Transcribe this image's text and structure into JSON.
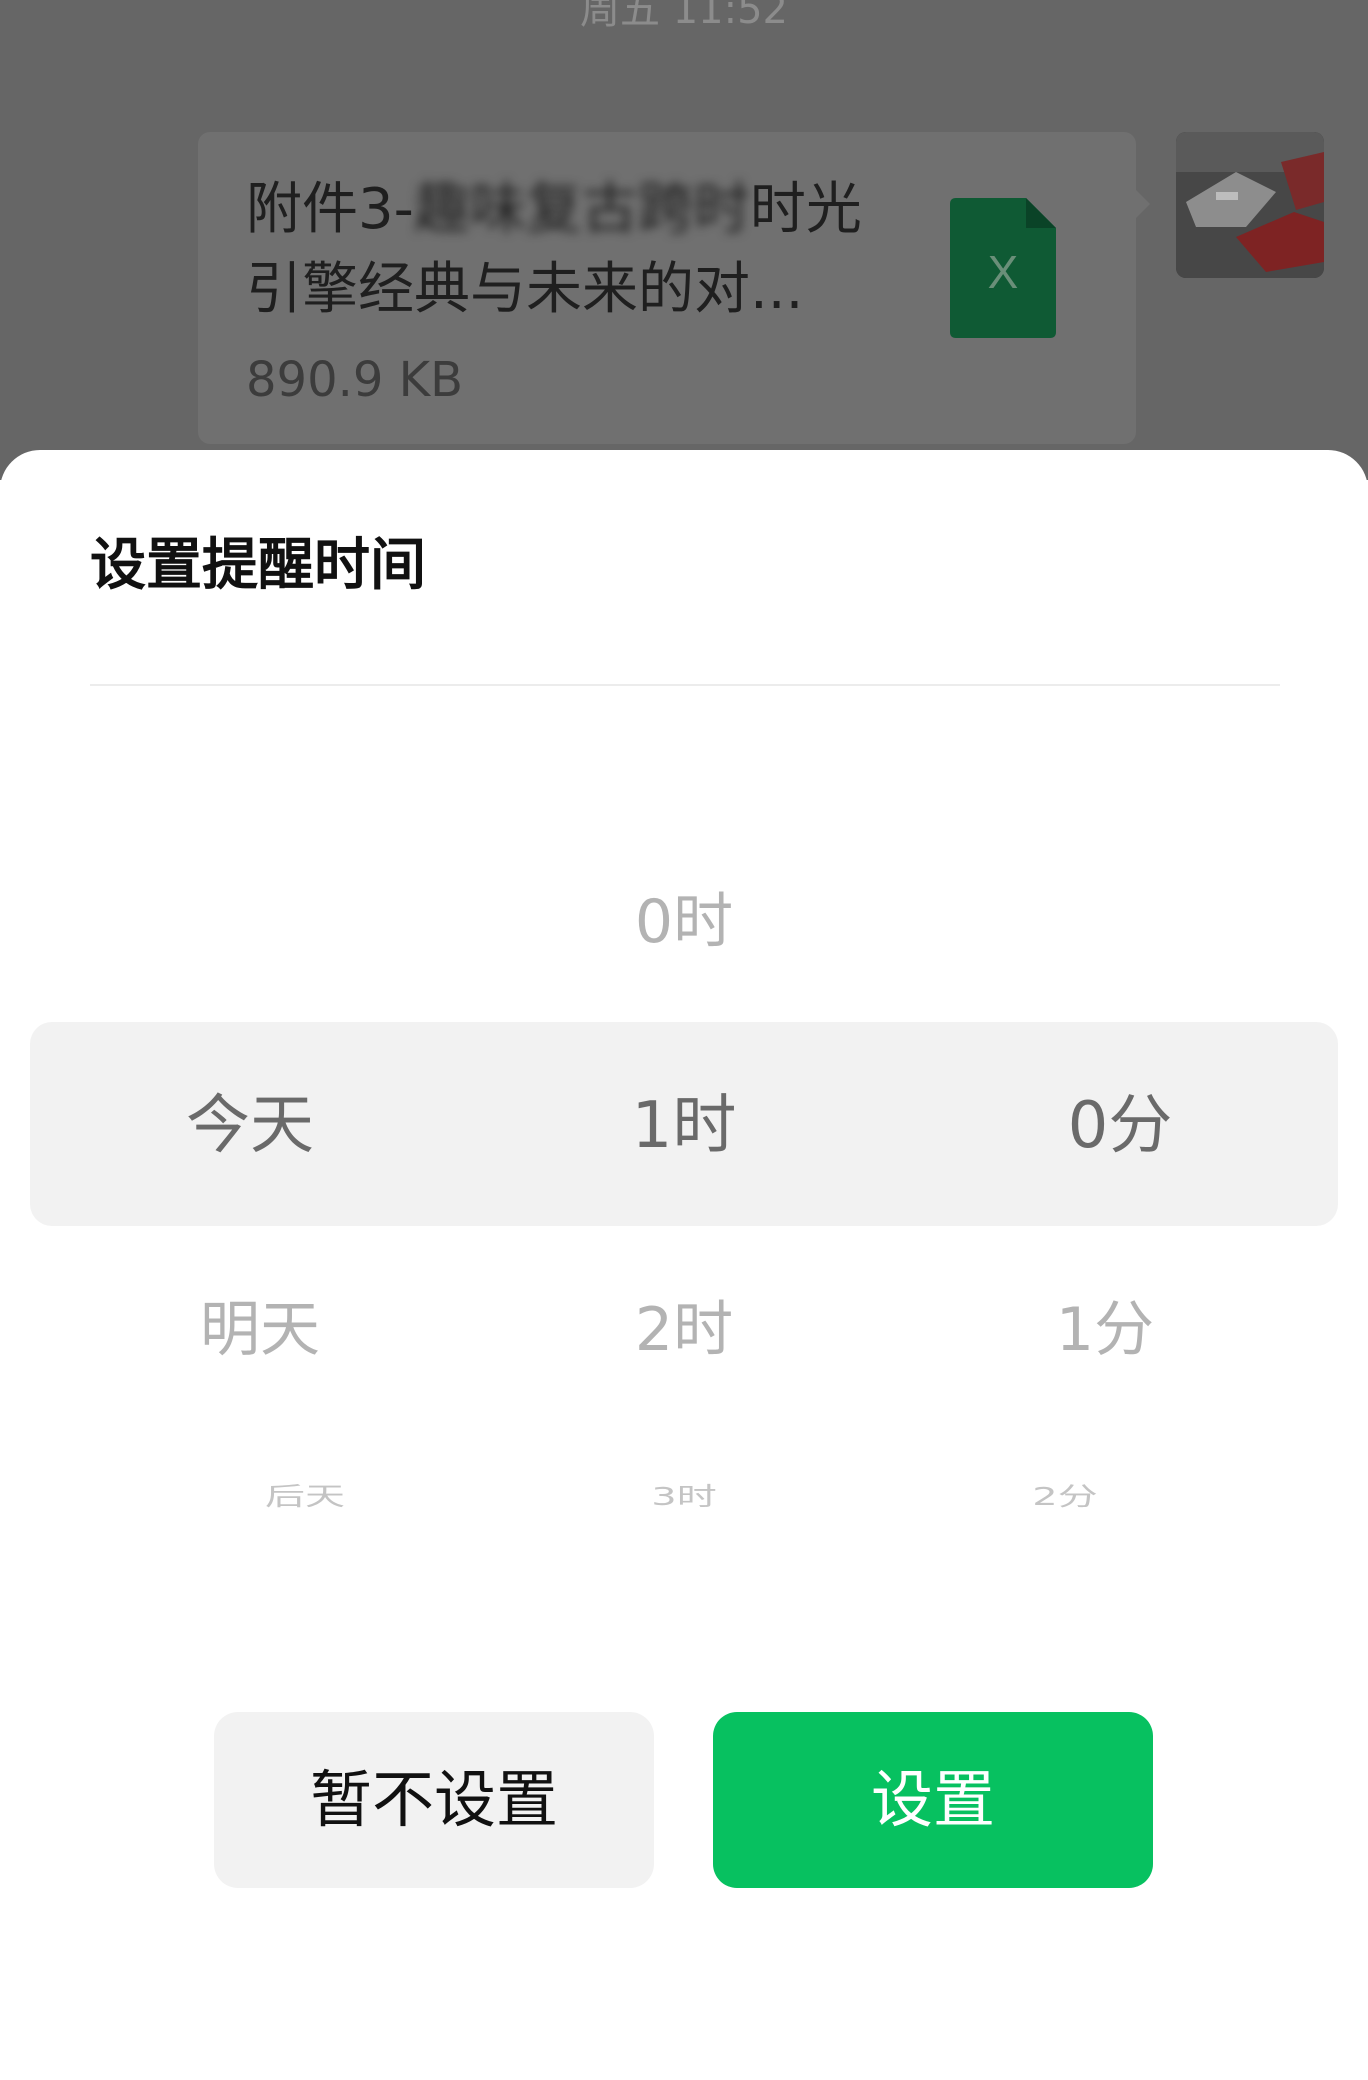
{
  "chat": {
    "timestamp": "周五 11:52",
    "file_message": {
      "name_prefix": "附件3-",
      "name_blurred": "趣味复古跨时",
      "name_suffix": "时光引擎经典与未来的对...",
      "size": "890.9 KB",
      "file_type_letter": "X",
      "file_icon_color": "#0f5a34"
    }
  },
  "reminder_sheet": {
    "title": "设置提醒时间",
    "picker": {
      "day_column": [
        "今天",
        "明天",
        "后天"
      ],
      "hour_column": [
        "0时",
        "1时",
        "2时",
        "3时"
      ],
      "minute_column": [
        "0分",
        "1分",
        "2分"
      ],
      "selected": {
        "day": "今天",
        "hour": "1时",
        "minute": "0分"
      }
    },
    "buttons": {
      "cancel_label": "暂不设置",
      "confirm_label": "设置"
    },
    "accent_color": "#07c160"
  }
}
